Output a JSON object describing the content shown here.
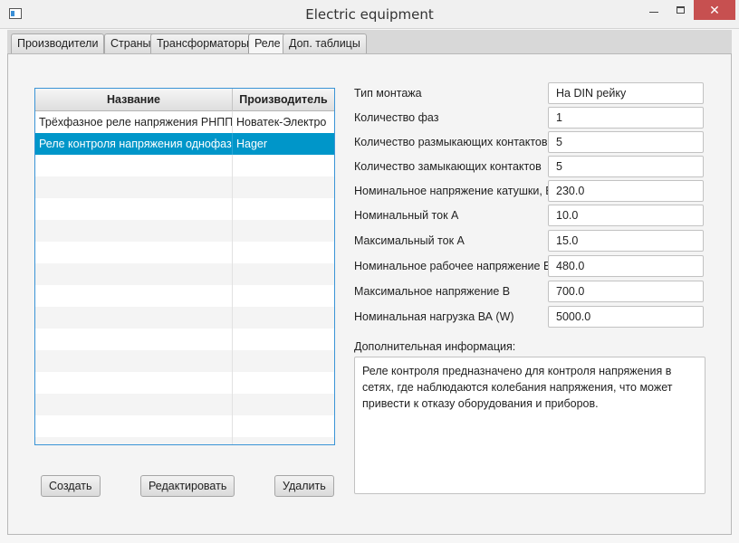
{
  "window": {
    "title": "Electric equipment",
    "close_symbol": "✕"
  },
  "tabs": [
    {
      "label": "Производители",
      "active": false
    },
    {
      "label": "Страны",
      "active": false
    },
    {
      "label": "Трансформаторы",
      "active": false
    },
    {
      "label": "Реле",
      "active": true
    },
    {
      "label": "Доп. таблицы",
      "active": false
    }
  ],
  "table": {
    "columns": [
      "Название",
      "Производитель"
    ],
    "rows": [
      {
        "name": "Трёхфазное реле напряжения РНПП...",
        "maker": "Новатек-Электро",
        "selected": false
      },
      {
        "name": "Реле контроля напряжения однофаз...",
        "maker": "Hager",
        "selected": true
      }
    ]
  },
  "buttons": {
    "create": "Создать",
    "edit": "Редактировать",
    "delete": "Удалить"
  },
  "form": {
    "fields": [
      {
        "label": "Тип монтажа",
        "value": "На DIN рейку"
      },
      {
        "label": "Количество фаз",
        "value": "1"
      },
      {
        "label": "Количество размыкающих контактов",
        "value": "5"
      },
      {
        "label": "Количество замыкающих контактов",
        "value": "5"
      },
      {
        "label": "Номинальное напряжение катушки, В",
        "value": "230.0"
      },
      {
        "label": "Номинальный ток А",
        "value": "10.0"
      },
      {
        "label": "Максимальный ток А",
        "value": "15.0"
      },
      {
        "label": "Номинальное рабочее напряжение В",
        "value": "480.0"
      },
      {
        "label": "Максимальное напряжение В",
        "value": "700.0"
      },
      {
        "label": "Номинальная нагрузка ВА (W)",
        "value": "5000.0"
      }
    ],
    "info_label": "Дополнительная информация:",
    "info_text": "Реле контроля предназначено для контроля напряжения в сетях, где наблюдаются колебания напряжения, что может привести к отказу оборудования и приборов."
  },
  "colors": {
    "selection": "#0096c9",
    "table_border": "#3a94d6",
    "close_button": "#c75050"
  }
}
